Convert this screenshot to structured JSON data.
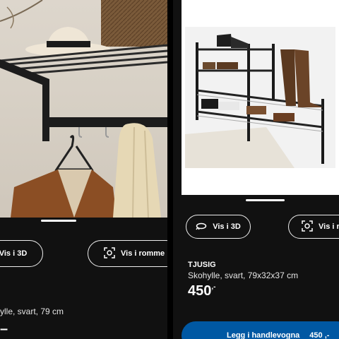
{
  "left": {
    "view_3d_label": "Vis i 3D",
    "view_room_label": "Vis i romme",
    "description": "ylle, svart, 79 cm",
    "price": "–",
    "price_suffix": ""
  },
  "right": {
    "view_3d_label": "Vis i 3D",
    "view_room_label": "Vis i r",
    "product_name": "TJUSIG",
    "description": "Skohylle, svart, 79x32x37 cm",
    "price": "450",
    "price_suffix": ",-",
    "add_to_cart_label": "Legg i handlevogna",
    "cart_price": "450 ,-"
  },
  "colors": {
    "background": "#111111",
    "cta": "#0058a3",
    "text": "#ffffff"
  },
  "icons": {
    "view_3d": "rotate-3d-icon",
    "view_room": "augmented-reality-icon"
  }
}
